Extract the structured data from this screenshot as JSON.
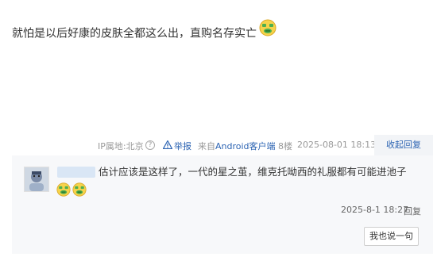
{
  "post": {
    "text": "就怕是以后好康的皮肤全都这么出，直购名存实亡",
    "emoji": "money-face-emoji"
  },
  "meta": {
    "ip_label": "IP属地:北京",
    "help_glyph": "?",
    "warn_glyph": "⚠",
    "report_label": "举报",
    "source_prefix": "来自",
    "source_link": "Android客户端",
    "floor": "8楼",
    "time": "2025-08-01 18:13",
    "collapse_reply_label": "收起回复"
  },
  "sub_reply": {
    "avatar": "user-avatar",
    "text": "估计应该是这样了，一代的星之茧，维克托呦西的礼服都有可能进池子",
    "emojis": [
      "money-face-emoji",
      "money-face-emoji"
    ],
    "time": "2025-8-1 18:27",
    "reply_label": "回复"
  },
  "say_button_label": "我也说一句",
  "colors": {
    "link": "#2d64b3",
    "meta_text": "#999999",
    "sub_bg": "#f7f8fa",
    "emoji_face": "#f6d34a",
    "emoji_money": "#4caf50"
  }
}
